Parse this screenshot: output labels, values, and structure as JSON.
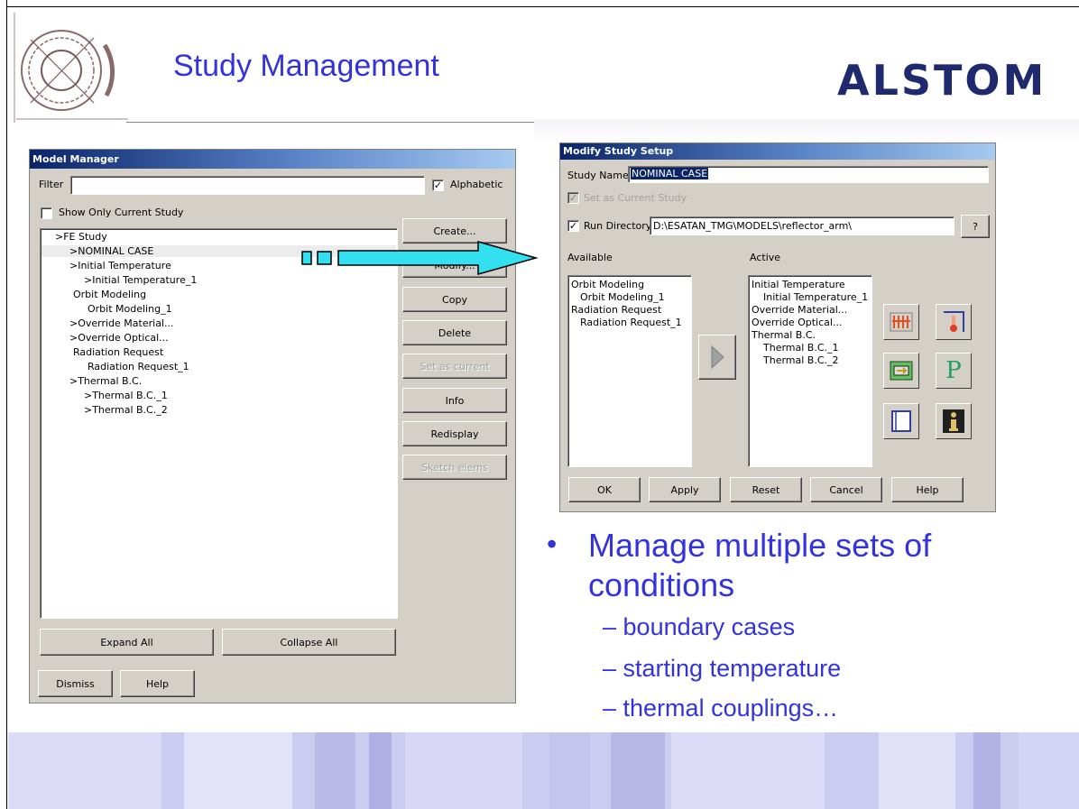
{
  "slide": {
    "title": "Study Management",
    "brand": "ALSTOM",
    "bullet": "Manage multiple sets of conditions",
    "bullet_line1": "Manage multiple sets of",
    "bullet_line2": "conditions",
    "subbullets": [
      "boundary cases",
      "starting temperature",
      "thermal couplings…"
    ]
  },
  "model_manager": {
    "title": "Model Manager",
    "filter_label": "Filter",
    "filter_value": "",
    "alphabetic_label": "Alphabetic",
    "alphabetic_checked": true,
    "show_only_current_label": "Show Only Current Study",
    "show_only_current_checked": false,
    "tree": [
      ">FE Study",
      ">NOMINAL CASE",
      ">Initial Temperature",
      ">Initial Temperature_1",
      "Orbit Modeling",
      "Orbit Modeling_1",
      ">Override Material...",
      ">Override Optical...",
      "Radiation Request",
      "Radiation Request_1",
      ">Thermal B.C.",
      ">Thermal B.C._1",
      ">Thermal B.C._2"
    ],
    "buttons": {
      "create": "Create...",
      "modify": "Modify...",
      "copy": "Copy",
      "delete": "Delete",
      "set_current": "Set as current",
      "info": "Info",
      "redisplay": "Redisplay",
      "sketch": "Sketch elems",
      "expand_all": "Expand All",
      "collapse_all": "Collapse All",
      "dismiss": "Dismiss",
      "help": "Help"
    }
  },
  "modify_study": {
    "title": "Modify Study Setup",
    "study_name_label": "Study Name",
    "study_name_value": "NOMINAL CASE",
    "set_current_label": "Set as Current Study",
    "run_dir_label": "Run Directory",
    "run_dir_value": "D:\\ESATAN_TMG\\MODELS\\reflector_arm\\",
    "browse_label": "?",
    "available_label": "Available",
    "active_label": "Active",
    "available_items": [
      "Orbit Modeling",
      "Orbit Modeling_1",
      "Radiation Request",
      "Radiation Request_1"
    ],
    "active_items": [
      "Initial Temperature",
      "Initial Temperature_1",
      "Override Material...",
      "Override Optical...",
      "Thermal B.C.",
      "Thermal B.C._1",
      "Thermal B.C._2"
    ],
    "buttons": {
      "ok": "OK",
      "apply": "Apply",
      "reset": "Reset",
      "cancel": "Cancel",
      "help": "Help"
    },
    "icons": [
      "boundary-conditions-icon",
      "temperature-icon",
      "orbit-icon",
      "property-p-icon",
      "panel-icon",
      "info-icon"
    ],
    "p_glyph": "P"
  },
  "colors": {
    "accent_text": "#3333dd",
    "brand": "#1f2a6e",
    "arrow": "#33e0f0",
    "band": "#ccccf0"
  }
}
